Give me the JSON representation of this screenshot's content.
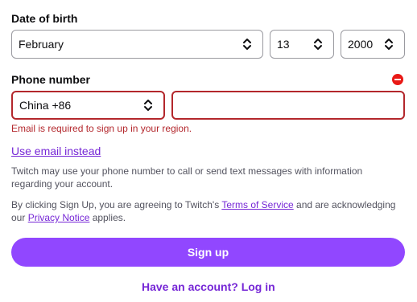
{
  "dob": {
    "label": "Date of birth",
    "month": "February",
    "day": "13",
    "year": "2000"
  },
  "phone": {
    "label": "Phone number",
    "country": "China +86",
    "number_value": "",
    "error": "Email is required to sign up in your region."
  },
  "use_email_link": "Use email instead",
  "disclaimer": "Twitch may use your phone number to call or send text messages with information regarding your account.",
  "terms": {
    "prefix": "By clicking Sign Up, you are agreeing to Twitch's ",
    "terms_link": "Terms of Service",
    "middle": " and are acknowledging our ",
    "privacy_link": "Privacy Notice",
    "suffix": " applies."
  },
  "signup_button": "Sign up",
  "login_link": "Have an account? Log in",
  "colors": {
    "accent": "#9147ff",
    "link": "#7627d6",
    "error": "#b3272c"
  }
}
